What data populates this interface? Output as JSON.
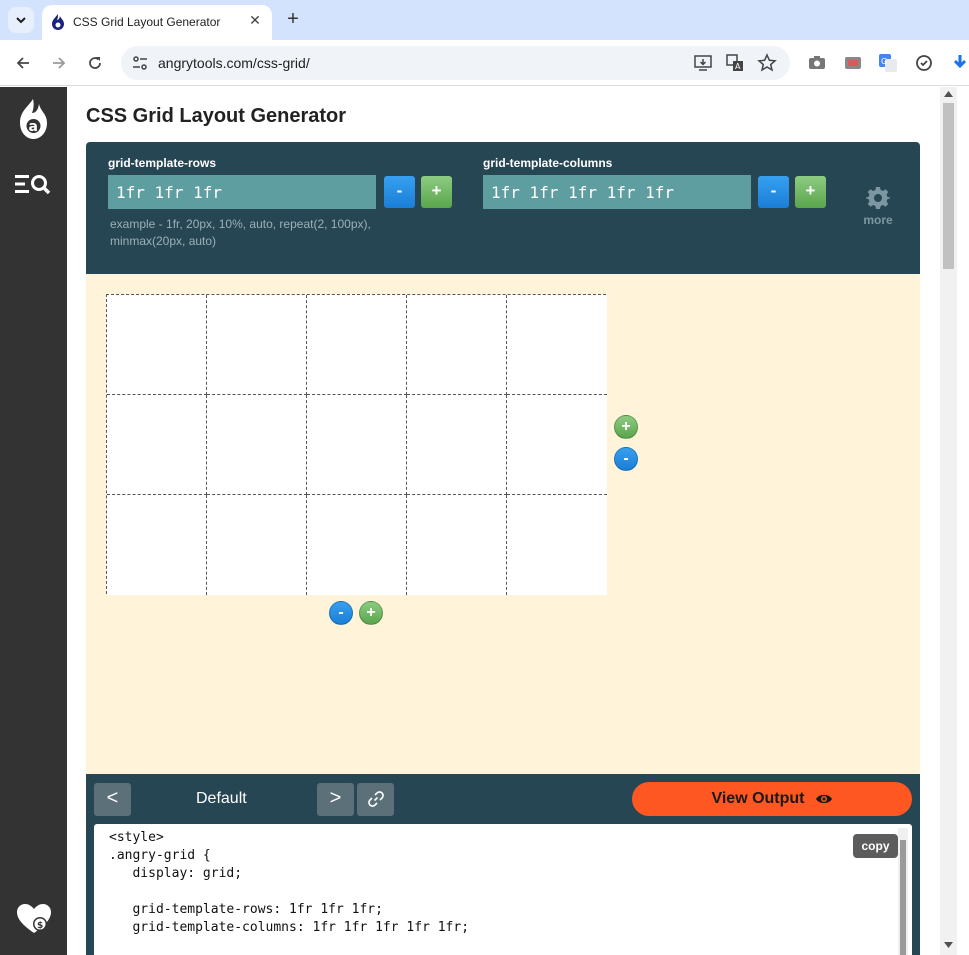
{
  "browser": {
    "tab_title": "CSS Grid Layout Generator",
    "tab_close": "✕",
    "new_tab": "+",
    "url": "angrytools.com/css-grid/"
  },
  "page": {
    "title": "CSS Grid Layout Generator"
  },
  "config": {
    "rows_label": "grid-template-rows",
    "rows_value": "1fr 1fr 1fr",
    "columns_label": "grid-template-columns",
    "columns_value": "1fr 1fr 1fr 1fr 1fr",
    "minus": "-",
    "plus": "+",
    "example": "example - 1fr, 20px, 10%, auto, repeat(2, 100px), minmax(20px, auto)",
    "more_label": "more"
  },
  "grid": {
    "rows": 3,
    "columns": 5
  },
  "output": {
    "prev": "<",
    "next": ">",
    "preset_name": "Default",
    "view_output": "View Output",
    "copy": "copy",
    "code_lines": [
      "<style>",
      ".angry-grid {",
      "   display: grid;",
      "",
      "   grid-template-rows: 1fr 1fr 1fr;",
      "   grid-template-columns: 1fr 1fr 1fr 1fr 1fr;"
    ]
  },
  "colors": {
    "header_bg": "#264653",
    "workspace_bg": "#fff4d9",
    "accent_orange": "#ff5722",
    "button_blue": "#1a7ed6",
    "button_green": "#5aa54c",
    "sidebar_bg": "#333333"
  },
  "icons": [
    "tab-search-icon",
    "angrytools-logo-icon",
    "back-icon",
    "forward-icon",
    "reload-icon",
    "site-info-icon",
    "install-icon",
    "translate-icon",
    "bookmark-star-icon",
    "screenshot-icon",
    "extension-icon",
    "google-translate-icon",
    "sync-icon",
    "download-icon",
    "menu-search-icon",
    "donate-heart-icon",
    "gear-icon",
    "eye-icon",
    "link-icon"
  ]
}
